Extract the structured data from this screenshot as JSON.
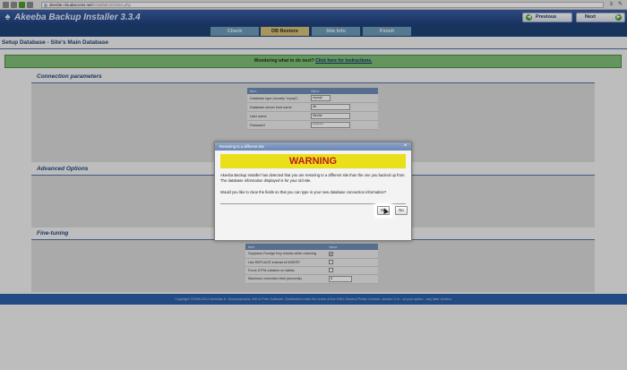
{
  "browser": {
    "url_host": "devsite.cloudaccess.net",
    "url_path": "/installation/index.php"
  },
  "header": {
    "title": "Akeeba Backup Installer 3.3.4",
    "previous_label": "Previous",
    "next_label": "Next"
  },
  "steps": [
    {
      "label": "Check",
      "active": false
    },
    {
      "label": "DB Restore",
      "active": true
    },
    {
      "label": "Site Info",
      "active": false
    },
    {
      "label": "Finish",
      "active": false
    }
  ],
  "page": {
    "title": "Setup Database - Site's Main Database",
    "notice_text": "Wondering what to do next?",
    "notice_link": "Click here for instructions."
  },
  "connection": {
    "heading": "Connection parameters",
    "col_item": "Item",
    "col_value": "Value",
    "rows": [
      {
        "label": "Database type (usually \"mysql\")",
        "value": "mysqli"
      },
      {
        "label": "Database server host name",
        "value": "db"
      },
      {
        "label": "User name",
        "value": "litesite"
      },
      {
        "label": "Password",
        "value": "********"
      }
    ]
  },
  "advanced": {
    "heading": "Advanced Options"
  },
  "finetuning": {
    "heading": "Fine-tuning",
    "col_item": "Item",
    "col_value": "Value",
    "rows": [
      {
        "label": "Suppress Foreign Key checks while restoring",
        "checked": "✔"
      },
      {
        "label": "Use REPLACE instead of INSERT",
        "checked": ""
      },
      {
        "label": "Force UTF8 collation on tables",
        "checked": ""
      },
      {
        "label": "Maximum execution time (seconds)",
        "value": "5"
      }
    ]
  },
  "footer": {
    "text": "Copyright ©2006-2011 Nicholas K. Dionysopoulos. AKI is Free Software. Distributed under the terms of the GNU General Public License, version 3 or - at your option - any later version."
  },
  "modal": {
    "title": "Restoring to a different site",
    "warning": "WARNING",
    "paragraph1": "Akeeba Backup Installer has detected that you are restoring to a different site than the one you backed up from. The database information displayed is for your old site.",
    "paragraph2": "Would you like to clear the fields so that you can type in your new database connection information?",
    "yes_label": "Yes",
    "no_label": "No"
  },
  "colors": {
    "header_blue": "#1f3f7c",
    "active_tab": "#d6c27a",
    "notice_green": "#82bf7a",
    "warning_yellow": "#e9df1b",
    "warning_red": "#c1181c"
  }
}
